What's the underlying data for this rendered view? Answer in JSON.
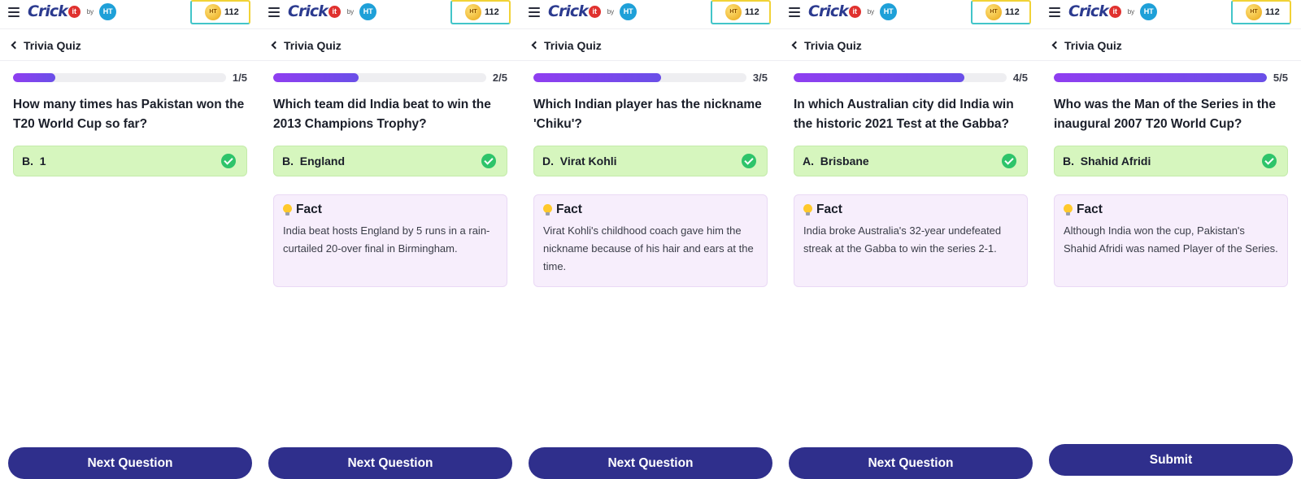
{
  "app": {
    "brand": "Crick",
    "brand_mark": "it",
    "by": "by",
    "ht": "HT",
    "coin_label": "HT",
    "coin_count": "112",
    "page_title": "Trivia Quiz"
  },
  "screens": [
    {
      "progress": "1/5",
      "progress_fraction": 0.2,
      "question": "How many times has Pakistan won the T20 World Cup so far?",
      "answer_letter": "B.",
      "answer_text": "1",
      "answer_status": "correct",
      "fact_title": "",
      "fact_text": "",
      "button": "Next Question"
    },
    {
      "progress": "2/5",
      "progress_fraction": 0.4,
      "question": "Which team did India beat to win the 2013 Champions Trophy?",
      "answer_letter": "B.",
      "answer_text": "England",
      "answer_status": "correct",
      "fact_title": "Fact",
      "fact_text": "India beat hosts England by 5 runs in a rain-curtailed 20-over final in Birmingham.",
      "button": "Next Question"
    },
    {
      "progress": "3/5",
      "progress_fraction": 0.6,
      "question": "Which Indian player has the nickname 'Chiku'?",
      "answer_letter": "D.",
      "answer_text": "Virat Kohli",
      "answer_status": "correct",
      "fact_title": "Fact",
      "fact_text": "Virat Kohli's childhood coach gave him the nickname because of his hair and ears at the time.",
      "button": "Next Question"
    },
    {
      "progress": "4/5",
      "progress_fraction": 0.8,
      "question": "In which Australian city did India win the historic 2021 Test at the Gabba?",
      "answer_letter": "A.",
      "answer_text": "Brisbane",
      "answer_status": "correct",
      "fact_title": "Fact",
      "fact_text": "India broke Australia's 32-year undefeated streak at the Gabba to win the series 2-1.",
      "button": "Next Question"
    },
    {
      "progress": "5/5",
      "progress_fraction": 1.0,
      "question": "Who was the Man of the Series in the inaugural 2007 T20 World Cup?",
      "answer_letter": "B.",
      "answer_text": "Shahid Afridi",
      "answer_status": "correct",
      "fact_title": "Fact",
      "fact_text": "Although India won the cup, Pakistan's Shahid Afridi was named Player of the Series.",
      "button": "Submit"
    }
  ],
  "colors": {
    "progress_fill": "#7b46ee",
    "answer_correct_bg": "#d6f6be",
    "check_green": "#2ec46a",
    "fact_bg": "#f7eefc",
    "cta_bg": "#2f2f8c"
  }
}
